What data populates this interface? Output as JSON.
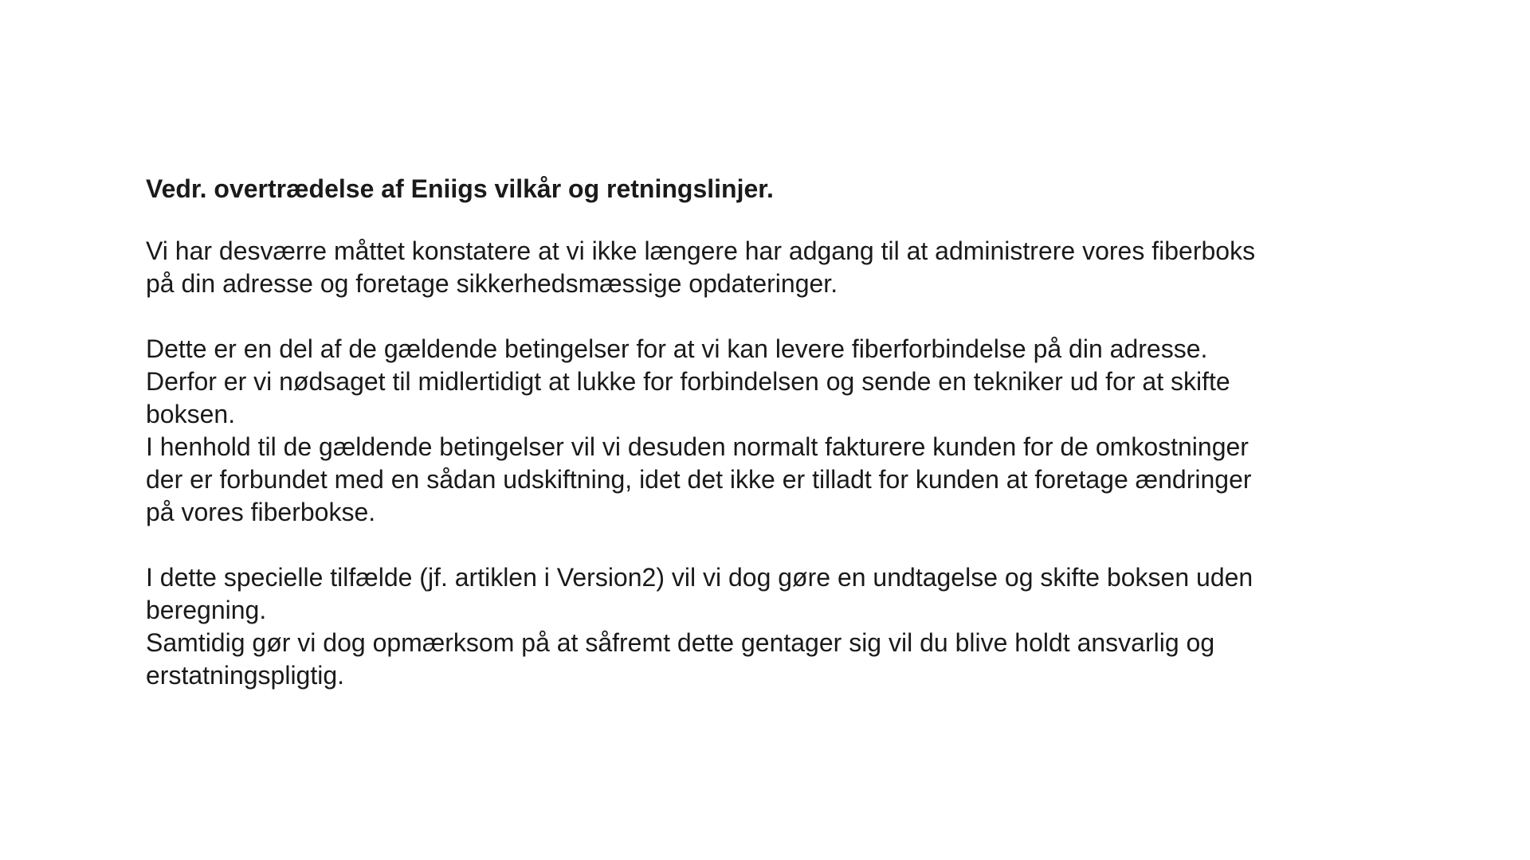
{
  "document": {
    "title": "Vedr. overtrædelse af Eniigs vilkår og retningslinjer.",
    "paragraphs": [
      {
        "lines": [
          "Vi har desværre måttet konstatere at vi ikke længere har adgang til at administrere vores fiberboks",
          "på din adresse og foretage sikkerhedsmæssige opdateringer."
        ]
      },
      {
        "lines": [
          "Dette er en del af de gældende betingelser for at vi kan levere fiberforbindelse på din adresse.",
          "Derfor er vi nødsaget til midlertidigt at lukke for forbindelsen og sende en tekniker ud for at skifte",
          "boksen.",
          "I henhold til de gældende betingelser vil vi desuden normalt fakturere kunden for de omkostninger",
          "der er forbundet med en sådan udskiftning, idet det ikke er tilladt for kunden at foretage ændringer",
          "på vores fiberbokse."
        ]
      },
      {
        "lines": [
          "I dette specielle tilfælde (jf. artiklen i Version2) vil vi dog gøre en undtagelse og skifte boksen uden",
          "beregning.",
          "Samtidig gør vi dog opmærksom på at såfremt dette gentager sig vil du blive holdt ansvarlig og",
          "erstatningspligtig."
        ]
      }
    ]
  }
}
